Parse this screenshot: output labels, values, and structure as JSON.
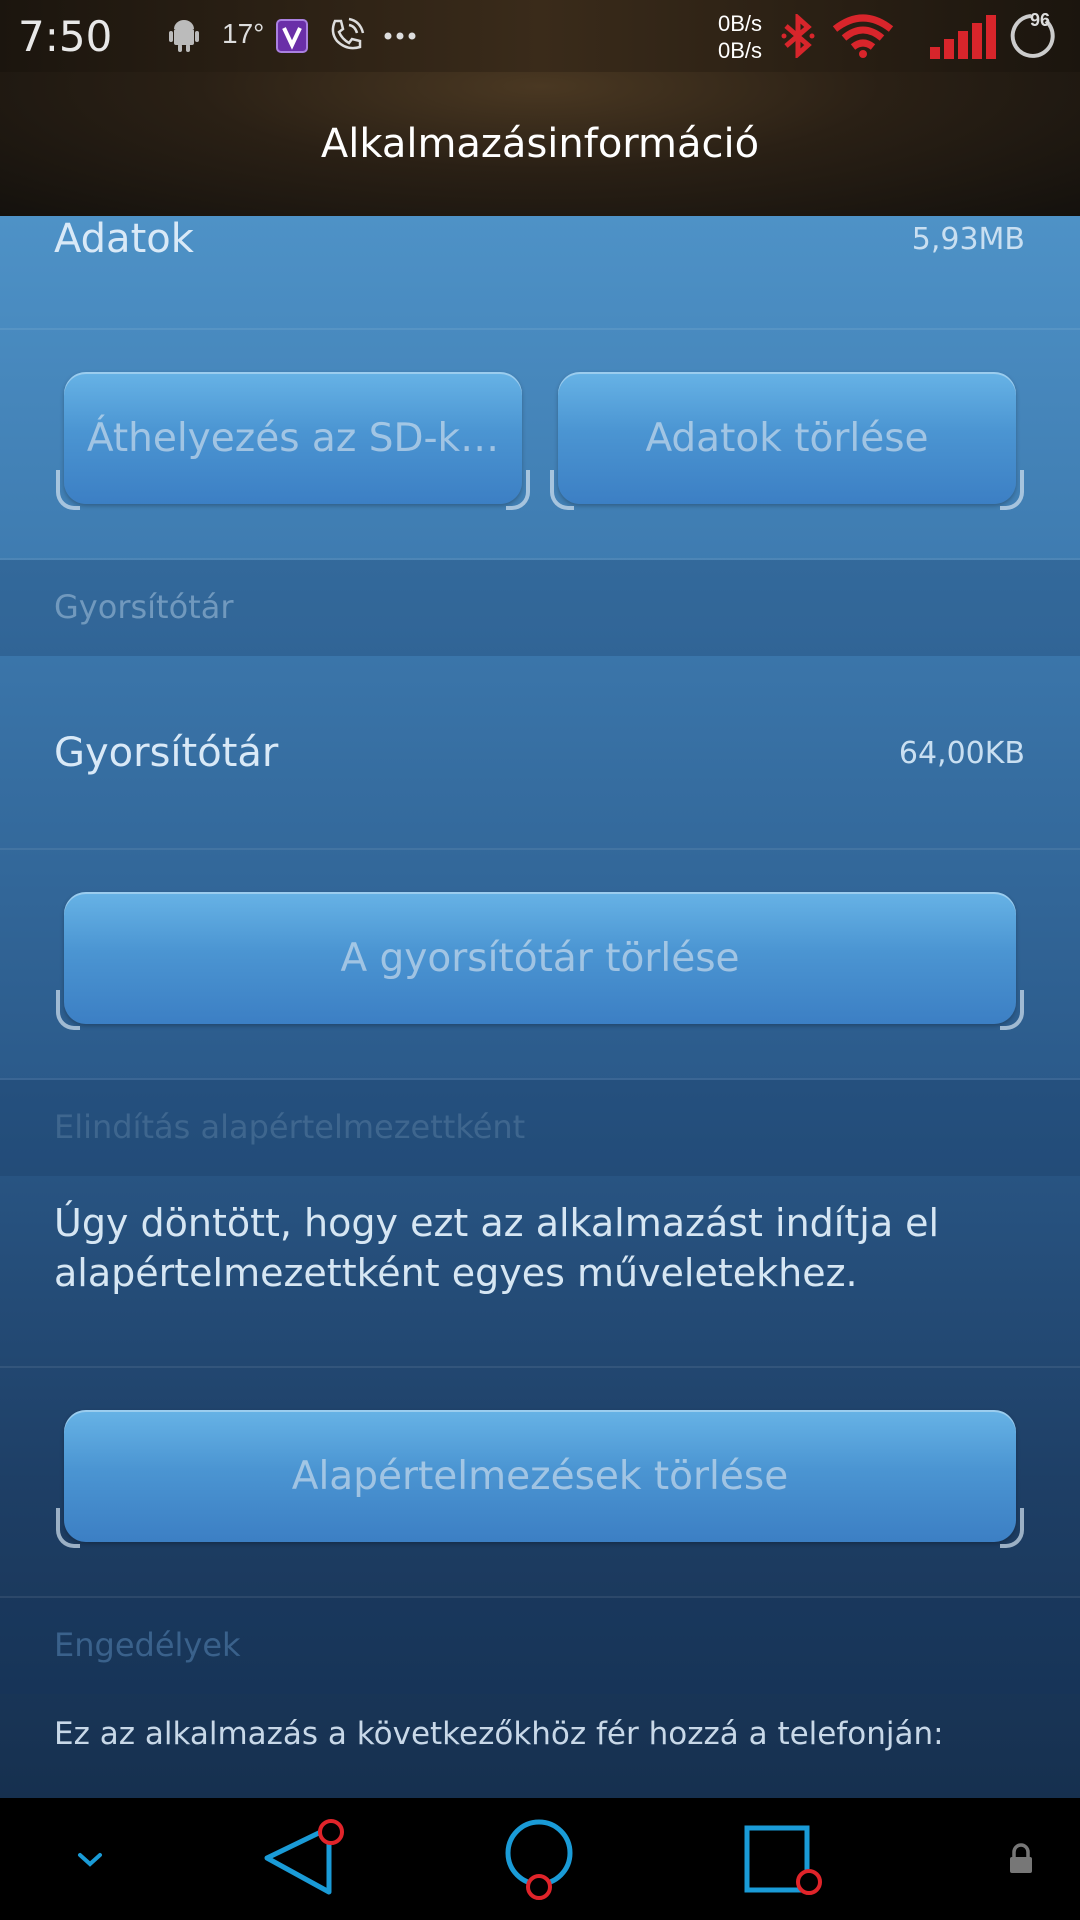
{
  "status_bar": {
    "time": "7:50",
    "temperature": "17°",
    "net_up": "0B/s",
    "net_down": "0B/s",
    "battery": "96",
    "icons": [
      "android-icon",
      "v-app-icon",
      "phone-call-icon",
      "more-icon",
      "bluetooth-icon",
      "wifi-icon",
      "signal-icon",
      "battery-ring-icon"
    ]
  },
  "title_bar": {
    "title": "Alkalmazásinformáció"
  },
  "storage": {
    "data_label": "Adatok",
    "data_value": "5,93MB",
    "move_button": "Áthelyezés az SD-k…",
    "clear_data_button": "Adatok törlése"
  },
  "cache": {
    "section_header": "Gyorsítótár",
    "label": "Gyorsítótár",
    "value": "64,00KB",
    "clear_button": "A gyorsítótár törlése"
  },
  "launch_default": {
    "section_header": "Elindítás alapértelmezettként",
    "description": "Úgy döntött, hogy ezt az alkalmazást indítja el alapértelmezettként egyes műveletekhez.",
    "clear_button": "Alapértelmezések törlése"
  },
  "permissions": {
    "section_header": "Engedélyek",
    "description": "Ez az alkalmazás a következőkhöz fér hozzá a telefonján:"
  },
  "nav_bar": {
    "icons": [
      "chevron-down-icon",
      "back-icon",
      "home-icon",
      "recents-icon",
      "lock-icon"
    ],
    "accent_color": "#1a9bd7",
    "badge_color": "#e0242a"
  }
}
